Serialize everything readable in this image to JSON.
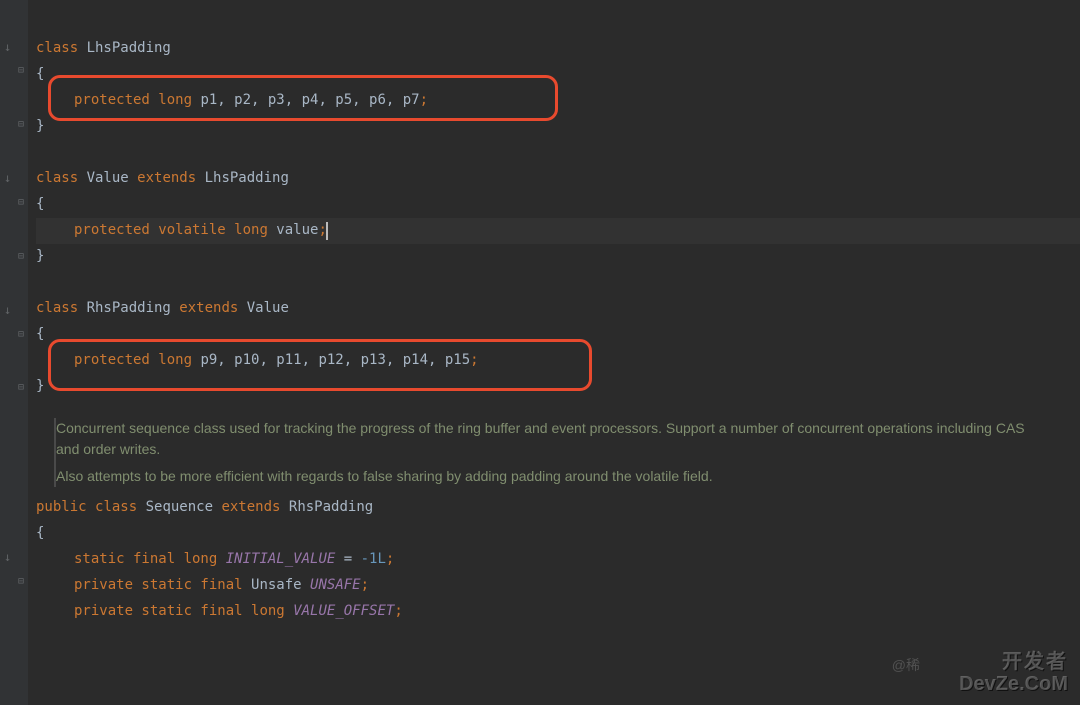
{
  "code": {
    "cls1": {
      "class_kw": "class ",
      "name": "LhsPadding",
      "open": "{",
      "field": {
        "mod": "protected ",
        "type": "long",
        "names": " p1, p2, p3, p4, p5, p6, p7",
        "semi": ";"
      },
      "close": "}"
    },
    "cls2": {
      "class_kw": "class ",
      "name": "Value ",
      "extends_kw": "extends ",
      "parent": "LhsPadding",
      "open": "{",
      "field": {
        "mod": "protected volatile ",
        "type": "long",
        "names": " value",
        "semi": ";"
      },
      "close": "}"
    },
    "cls3": {
      "class_kw": "class ",
      "name": "RhsPadding ",
      "extends_kw": "extends ",
      "parent": "Value",
      "open": "{",
      "field": {
        "mod": "protected ",
        "type": "long",
        "names": " p9, p10, p11, p12, p13, p14, p15",
        "semi": ";"
      },
      "close": "}"
    },
    "doc": {
      "p1": "Concurrent sequence class used for tracking the progress of the ring buffer and event processors. Support a number of concurrent operations including CAS and order writes.",
      "p2": "Also attempts to be more efficient with regards to false sharing by adding padding around the volatile field."
    },
    "cls4": {
      "pub": "public ",
      "class_kw": "class ",
      "name": "Sequence ",
      "extends_kw": "extends ",
      "parent": "RhsPadding",
      "open": "{",
      "f1": {
        "mods": "static final ",
        "type": "long ",
        "name": "INITIAL_VALUE",
        "eq": " = ",
        "val": "-1L",
        "semi": ";"
      },
      "f2": {
        "mods": "private static final ",
        "type": "Unsafe ",
        "name": "UNSAFE",
        "semi": ";"
      },
      "f3": {
        "mods": "private static final ",
        "type": "long ",
        "name": "VALUE_OFFSET",
        "semi": ";"
      }
    }
  },
  "watermark": {
    "cn": "开发者",
    "en": "DevZe.CoM",
    "author": "@稀"
  }
}
